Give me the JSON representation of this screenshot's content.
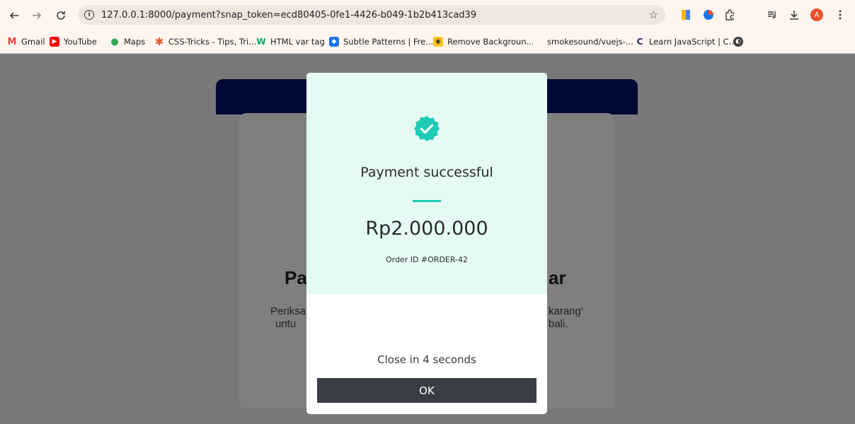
{
  "browser": {
    "url": "127.0.0.1:8000/payment?snap_token=ecd80405-0fe1-4426-b049-1b2b413cad39",
    "avatar_letter": "A",
    "bookmarks": [
      {
        "label": "Gmail",
        "icon": "gmail-icon",
        "color": "#ea4335"
      },
      {
        "label": "YouTube",
        "icon": "youtube-icon",
        "color": "#ff0000"
      },
      {
        "label": "Maps",
        "icon": "maps-icon",
        "color": "#34a853"
      },
      {
        "label": "CSS-Tricks - Tips, Tri...",
        "icon": "css-tricks-icon",
        "color": "#e8532f"
      },
      {
        "label": "HTML var tag",
        "icon": "w3schools-icon",
        "color": "#04aa6d"
      },
      {
        "label": "Subtle Patterns | Fre...",
        "icon": "subtle-patterns-icon",
        "color": "#1a73e8"
      },
      {
        "label": "Remove Backgroun...",
        "icon": "remove-bg-icon",
        "color": "#f9c514"
      },
      {
        "label": "smokesound/vuejs-...",
        "icon": "github-icon",
        "color": "#ffffff"
      },
      {
        "label": "Learn JavaScript | C...",
        "icon": "codecademy-icon",
        "color": "#1f2b4d"
      }
    ]
  },
  "page": {
    "title_left": "Pa",
    "title_right": "ar",
    "text_line1_left": "Periksa",
    "text_line1_right": "karang'",
    "text_line2_left": "untu",
    "text_line2_right": "bali."
  },
  "modal": {
    "icon": "check-badge-icon",
    "title": "Payment successful",
    "amount": "Rp2.000.000",
    "order": "Order ID #ORDER-42",
    "close_text": "Close in 4 seconds",
    "ok_label": "OK",
    "accent_color": "#1ecbb4"
  }
}
